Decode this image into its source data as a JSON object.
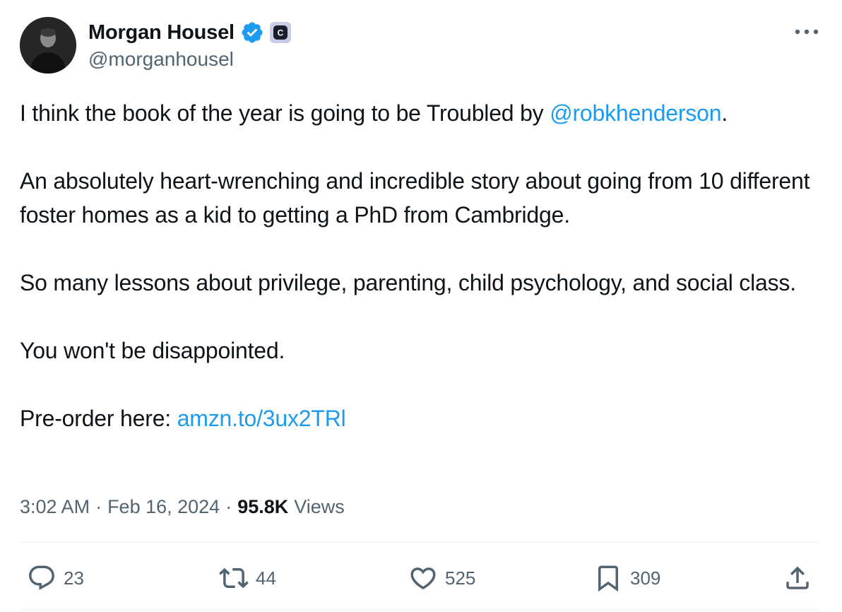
{
  "author": {
    "display_name": "Morgan Housel",
    "handle": "@morganhousel",
    "avatar_icon": "avatar-photo",
    "verified_icon": "verified-badge-icon",
    "affiliate_icon": "collab-fund-badge-icon",
    "affiliate_letter": "C"
  },
  "tweet": {
    "para1_text": "I think the book of the year is going to be Troubled by ",
    "para1_mention": "@robkhenderson",
    "para1_end": ".",
    "para2_text": "An absolutely heart-wrenching and incredible story about going from 10 different foster homes as a kid to getting a PhD from Cambridge.",
    "para3_text": "So many lessons about privilege, parenting, child psychology, and social class.",
    "para4_text": "You won't be disappointed.",
    "para5_text": "Pre-order here: ",
    "para5_link": "amzn.to/3ux2TRl"
  },
  "meta": {
    "time": "3:02 AM",
    "separator": "·",
    "date": "Feb 16, 2024",
    "views_count": "95.8K",
    "views_label": "Views"
  },
  "actions": {
    "replies": "23",
    "reposts": "44",
    "likes": "525",
    "bookmarks": "309"
  },
  "colors": {
    "link": "#1d9bf0",
    "secondary_text": "#536471",
    "primary_text": "#0f1419",
    "divider": "#eff3f4"
  }
}
